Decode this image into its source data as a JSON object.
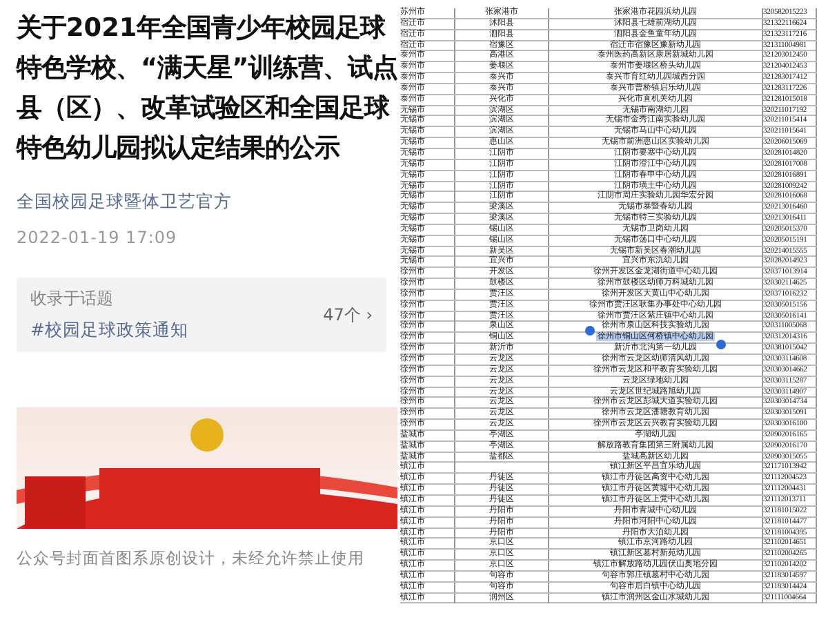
{
  "article": {
    "title": "关于2021年全国青少年校园足球特色学校、“满天星”训练营、试点县（区）、改革试验区和全国足球特色幼儿园拟认定结果的公示",
    "account": "全国校园足球暨体卫艺官方",
    "date": "2022-01-19 17:09",
    "topic": {
      "label": "收录于话题",
      "tag": "#校园足球政策通知",
      "count": "47个",
      "chevron": "›"
    },
    "caption": "公众号封面首图系原创设计，未经允许禁止使用"
  },
  "table": {
    "rows": [
      {
        "city": "苏州市",
        "district": "张家港市",
        "name": "张家港市花园浜幼儿园",
        "code": "320582015223",
        "selected": false
      },
      {
        "city": "宿迁市",
        "district": "沭阳县",
        "name": "沭阳县七雄前湖幼儿园",
        "code": "321322116624",
        "selected": false
      },
      {
        "city": "宿迁市",
        "district": "泗阳县",
        "name": "泗阳县金鱼童年幼儿园",
        "code": "321323117216",
        "selected": false
      },
      {
        "city": "宿迁市",
        "district": "宿豫区",
        "name": "宿迁市宿豫区豫新幼儿园",
        "code": "321311004981",
        "selected": false
      },
      {
        "city": "泰州市",
        "district": "高港区",
        "name": "泰州医药高新区康居新城幼儿园",
        "code": "321203012450",
        "selected": false
      },
      {
        "city": "泰州市",
        "district": "姜堰区",
        "name": "泰州市姜堰区桥头幼儿园",
        "code": "321204012453",
        "selected": false
      },
      {
        "city": "泰州市",
        "district": "泰兴市",
        "name": "泰兴市育红幼儿园城西分园",
        "code": "321283017412",
        "selected": false
      },
      {
        "city": "泰州市",
        "district": "泰兴市",
        "name": "泰兴市曹桥镇启乐幼儿园",
        "code": "321283117226",
        "selected": false
      },
      {
        "city": "泰州市",
        "district": "兴化市",
        "name": "兴化市直机关幼儿园",
        "code": "321281015018",
        "selected": false
      },
      {
        "city": "无锡市",
        "district": "滨湖区",
        "name": "无锡市南湖幼儿园",
        "code": "320211017192",
        "selected": false
      },
      {
        "city": "无锡市",
        "district": "滨湖区",
        "name": "无锡市金秀江南实验幼儿园",
        "code": "320211015414",
        "selected": false
      },
      {
        "city": "无锡市",
        "district": "滨湖区",
        "name": "无锡市马山中心幼儿园",
        "code": "320211015641",
        "selected": false
      },
      {
        "city": "无锡市",
        "district": "惠山区",
        "name": "无锡市前洲惠山区实验幼儿园",
        "code": "320206015069",
        "selected": false
      },
      {
        "city": "无锡市",
        "district": "江阴市",
        "name": "江阴市要塞中心幼儿园",
        "code": "320281014820",
        "selected": false
      },
      {
        "city": "无锡市",
        "district": "江阴市",
        "name": "江阴市澄江中心幼儿园",
        "code": "320281017008",
        "selected": false
      },
      {
        "city": "无锡市",
        "district": "江阴市",
        "name": "江阴市春申中心幼儿园",
        "code": "320281016891",
        "selected": false
      },
      {
        "city": "无锡市",
        "district": "江阴市",
        "name": "江阴市璜土中心幼儿园",
        "code": "320281009242",
        "selected": false
      },
      {
        "city": "无锡市",
        "district": "江阴市",
        "name": "江阴市周庄实验幼儿园华宏分园",
        "code": "320281016068",
        "selected": false
      },
      {
        "city": "无锡市",
        "district": "梁溪区",
        "name": "无锡市暴暨春幼儿园",
        "code": "320213016460",
        "selected": false
      },
      {
        "city": "无锡市",
        "district": "梁溪区",
        "name": "无锡市特三实验幼儿园",
        "code": "320213016411",
        "selected": false
      },
      {
        "city": "无锡市",
        "district": "锡山区",
        "name": "无锡市卫岗幼儿园",
        "code": "320205015370",
        "selected": false
      },
      {
        "city": "无锡市",
        "district": "锡山区",
        "name": "无锡市荡口中心幼儿园",
        "code": "320205015191",
        "selected": false
      },
      {
        "city": "无锡市",
        "district": "新吴区",
        "name": "无锡市新吴区春潮幼儿园",
        "code": "320214015555",
        "selected": false
      },
      {
        "city": "无锡市",
        "district": "宜兴市",
        "name": "宜兴市东氿幼儿园",
        "code": "320282014923",
        "selected": false
      },
      {
        "city": "徐州市",
        "district": "开发区",
        "name": "徐州开发区金龙湖街道中心幼儿园",
        "code": "320371013914",
        "selected": false
      },
      {
        "city": "徐州市",
        "district": "鼓楼区",
        "name": "徐州市鼓楼区幼师万科城幼儿园",
        "code": "320302114625",
        "selected": false
      },
      {
        "city": "徐州市",
        "district": "贾汪区",
        "name": "徐州开发区大黄山中心幼儿园",
        "code": "320371016232",
        "selected": false
      },
      {
        "city": "徐州市",
        "district": "贾汪区",
        "name": "徐州市贾汪区耿集办事处中心幼儿园",
        "code": "320305015156",
        "selected": false
      },
      {
        "city": "徐州市",
        "district": "贾汪区",
        "name": "徐州市贾汪区紫庄镇中心幼儿园",
        "code": "320305016141",
        "selected": false
      },
      {
        "city": "徐州市",
        "district": "泉山区",
        "name": "徐州市泉山区科技实验幼儿园",
        "code": "320311005068",
        "selected": false
      },
      {
        "city": "徐州市",
        "district": "铜山区",
        "name": "徐州市铜山区何桥镇中心幼儿园",
        "code": "320312014316",
        "selected": true
      },
      {
        "city": "徐州市",
        "district": "新沂市",
        "name": "新沂市北沟第一幼儿园",
        "code": "320381015042",
        "selected": false
      },
      {
        "city": "徐州市",
        "district": "云龙区",
        "name": "徐州市云龙区幼师清风幼儿园",
        "code": "320303114608",
        "selected": false
      },
      {
        "city": "徐州市",
        "district": "云龙区",
        "name": "徐州市云龙区和平教育实验幼儿园",
        "code": "320303014662",
        "selected": false
      },
      {
        "city": "徐州市",
        "district": "云龙区",
        "name": "云龙区绿地幼儿园",
        "code": "320303115287",
        "selected": false
      },
      {
        "city": "徐州市",
        "district": "云龙区",
        "name": "云龙区世纪城路旭幼儿园",
        "code": "320303114907",
        "selected": false
      },
      {
        "city": "徐州市",
        "district": "云龙区",
        "name": "徐州市云龙区彭城大道实验幼儿园",
        "code": "320303014734",
        "selected": false
      },
      {
        "city": "徐州市",
        "district": "云龙区",
        "name": "徐州市云龙区潘塘教育幼儿园",
        "code": "320303015091",
        "selected": false
      },
      {
        "city": "徐州市",
        "district": "云龙区",
        "name": "徐州市云龙区云兴教育实验幼儿园",
        "code": "320303016100",
        "selected": false
      },
      {
        "city": "盐城市",
        "district": "亭湖区",
        "name": "亭湖幼儿园",
        "code": "320902016165",
        "selected": false
      },
      {
        "city": "盐城市",
        "district": "亭湖区",
        "name": "解放路教育集团第三附属幼儿园",
        "code": "320902016170",
        "selected": false
      },
      {
        "city": "盐城市",
        "district": "盐都区",
        "name": "盐城高新区幼儿园",
        "code": "320903015055",
        "selected": false
      },
      {
        "city": "镇江市",
        "name": "镇江新区平昌宜乐幼儿园",
        "code": "321171013942",
        "selected": false
      },
      {
        "city": "镇江市",
        "district": "丹徒区",
        "name": "镇江市丹徒区高资中心幼儿园",
        "code": "321112004523",
        "selected": false
      },
      {
        "city": "镇江市",
        "district": "丹徒区",
        "name": "镇江市丹徒区黄墟中心幼儿园",
        "code": "321112004431",
        "selected": false
      },
      {
        "city": "镇江市",
        "district": "丹徒区",
        "name": "镇江市丹徒区上党中心幼儿园",
        "code": "321112013711",
        "selected": false
      },
      {
        "city": "镇江市",
        "district": "丹阳市",
        "name": "丹阳市青城中心幼儿园",
        "code": "321181015022",
        "selected": false
      },
      {
        "city": "镇江市",
        "district": "丹阳市",
        "name": "丹阳市河阳中心幼儿园",
        "code": "321181014477",
        "selected": false
      },
      {
        "city": "镇江市",
        "district": "丹阳市",
        "name": "丹阳市大泊幼儿园",
        "code": "321181004395",
        "selected": false
      },
      {
        "city": "镇江市",
        "district": "京口区",
        "name": "镇江市京河路幼儿园",
        "code": "321102014651",
        "selected": false
      },
      {
        "city": "镇江市",
        "district": "京口区",
        "name": "镇江新区墓村新苑幼儿园",
        "code": "321102004265",
        "selected": false
      },
      {
        "city": "镇江市",
        "district": "京口区",
        "name": "镇江市解放路幼儿园伏山奥地分园",
        "code": "321102014202",
        "selected": false
      },
      {
        "city": "镇江市",
        "district": "句容市",
        "name": "句容市郭庄镇墓村中心幼儿园",
        "code": "321183014597",
        "selected": false
      },
      {
        "city": "镇江市",
        "district": "句容市",
        "name": "句容市后白镇中心幼儿园",
        "code": "321183014424",
        "selected": false
      },
      {
        "city": "镇江市",
        "district": "润州区",
        "name": "镇江市润州区金山水城幼儿园",
        "code": "321111004664",
        "selected": false
      }
    ]
  }
}
